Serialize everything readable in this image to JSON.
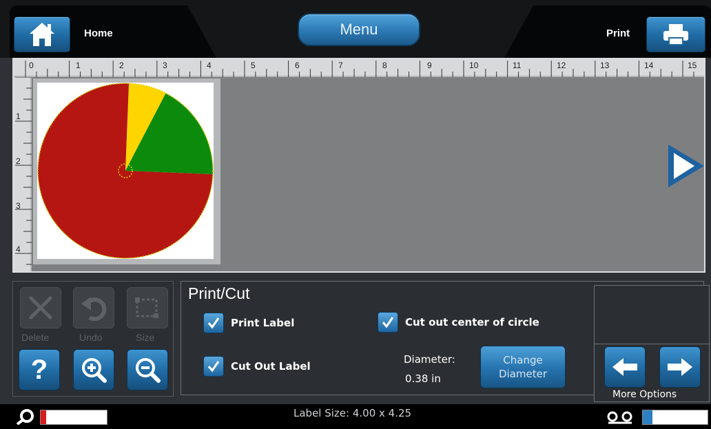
{
  "header": {
    "home_label": "Home",
    "menu_label": "Menu",
    "print_label": "Print"
  },
  "ruler": {
    "top_numbers": [
      "0",
      "1",
      "2",
      "3",
      "4",
      "5",
      "6",
      "7",
      "8",
      "9",
      "10",
      "11",
      "12",
      "13",
      "14",
      "15"
    ],
    "left_numbers": [
      "1",
      "2",
      "3",
      "4"
    ]
  },
  "pie_chart": {
    "slices": [
      {
        "color": "#ffd500",
        "value": 0.07
      },
      {
        "color": "#0c8a0c",
        "value": 0.18
      },
      {
        "color": "#b51611",
        "value": 0.75
      }
    ]
  },
  "tools": {
    "delete_label": "Delete",
    "undo_label": "Undo",
    "size_label": "Size"
  },
  "print_cut": {
    "title": "Print/Cut",
    "print_label": "Print Label",
    "cut_out_label": "Cut Out Label",
    "cut_center_label": "Cut out center of circle",
    "diameter_label": "Diameter:",
    "diameter_value": "0.38  in",
    "change_diameter_line1": "Change",
    "change_diameter_line2": "Diameter"
  },
  "more_options_label": "More Options",
  "status": {
    "label_size": "Label Size: 4.00 x 4.25",
    "ribbon_level": 0.08,
    "ink_level": 0.15
  },
  "colors": {
    "accent_blue": "#1f6aa3",
    "ribbon_fill": "#d81c1c",
    "ink_fill": "#2c7fc0"
  }
}
